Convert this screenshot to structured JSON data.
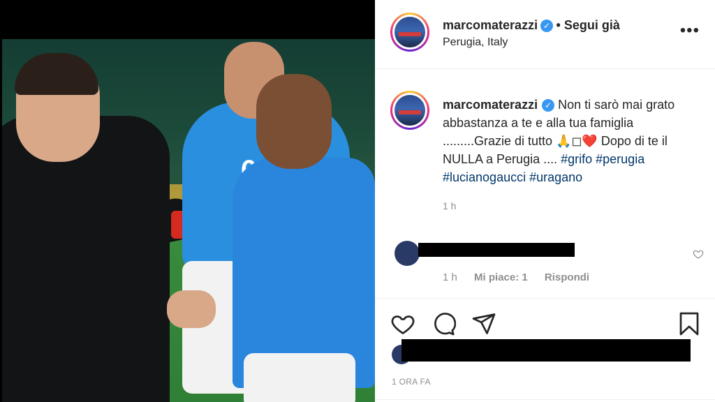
{
  "post": {
    "username": "marcomaterazzi",
    "verified_glyph": "✓",
    "follow_label": "• Segui già",
    "location": "Perugia, Italy",
    "more_label": "•••"
  },
  "caption": {
    "username": "marcomaterazzi",
    "text_1": "Non ti sarò mai grato abbastanza a te e alla tua famiglia .........Grazie di tutto ",
    "emoji": "🙏◻❤️",
    "text_2": " Dopo di te il NULLA a Perugia .... ",
    "hashtags": [
      "#grifo",
      "#perugia",
      "#lucianogaucci",
      "#uragano"
    ],
    "time": "1 h"
  },
  "comment": {
    "time": "1 h",
    "likes": "Mi piace: 1",
    "reply": "Rispondi"
  },
  "posted_ago": "1 ORA FA",
  "icons": [
    "heart-icon",
    "comment-icon",
    "share-icon",
    "bookmark-icon",
    "more-icon"
  ]
}
